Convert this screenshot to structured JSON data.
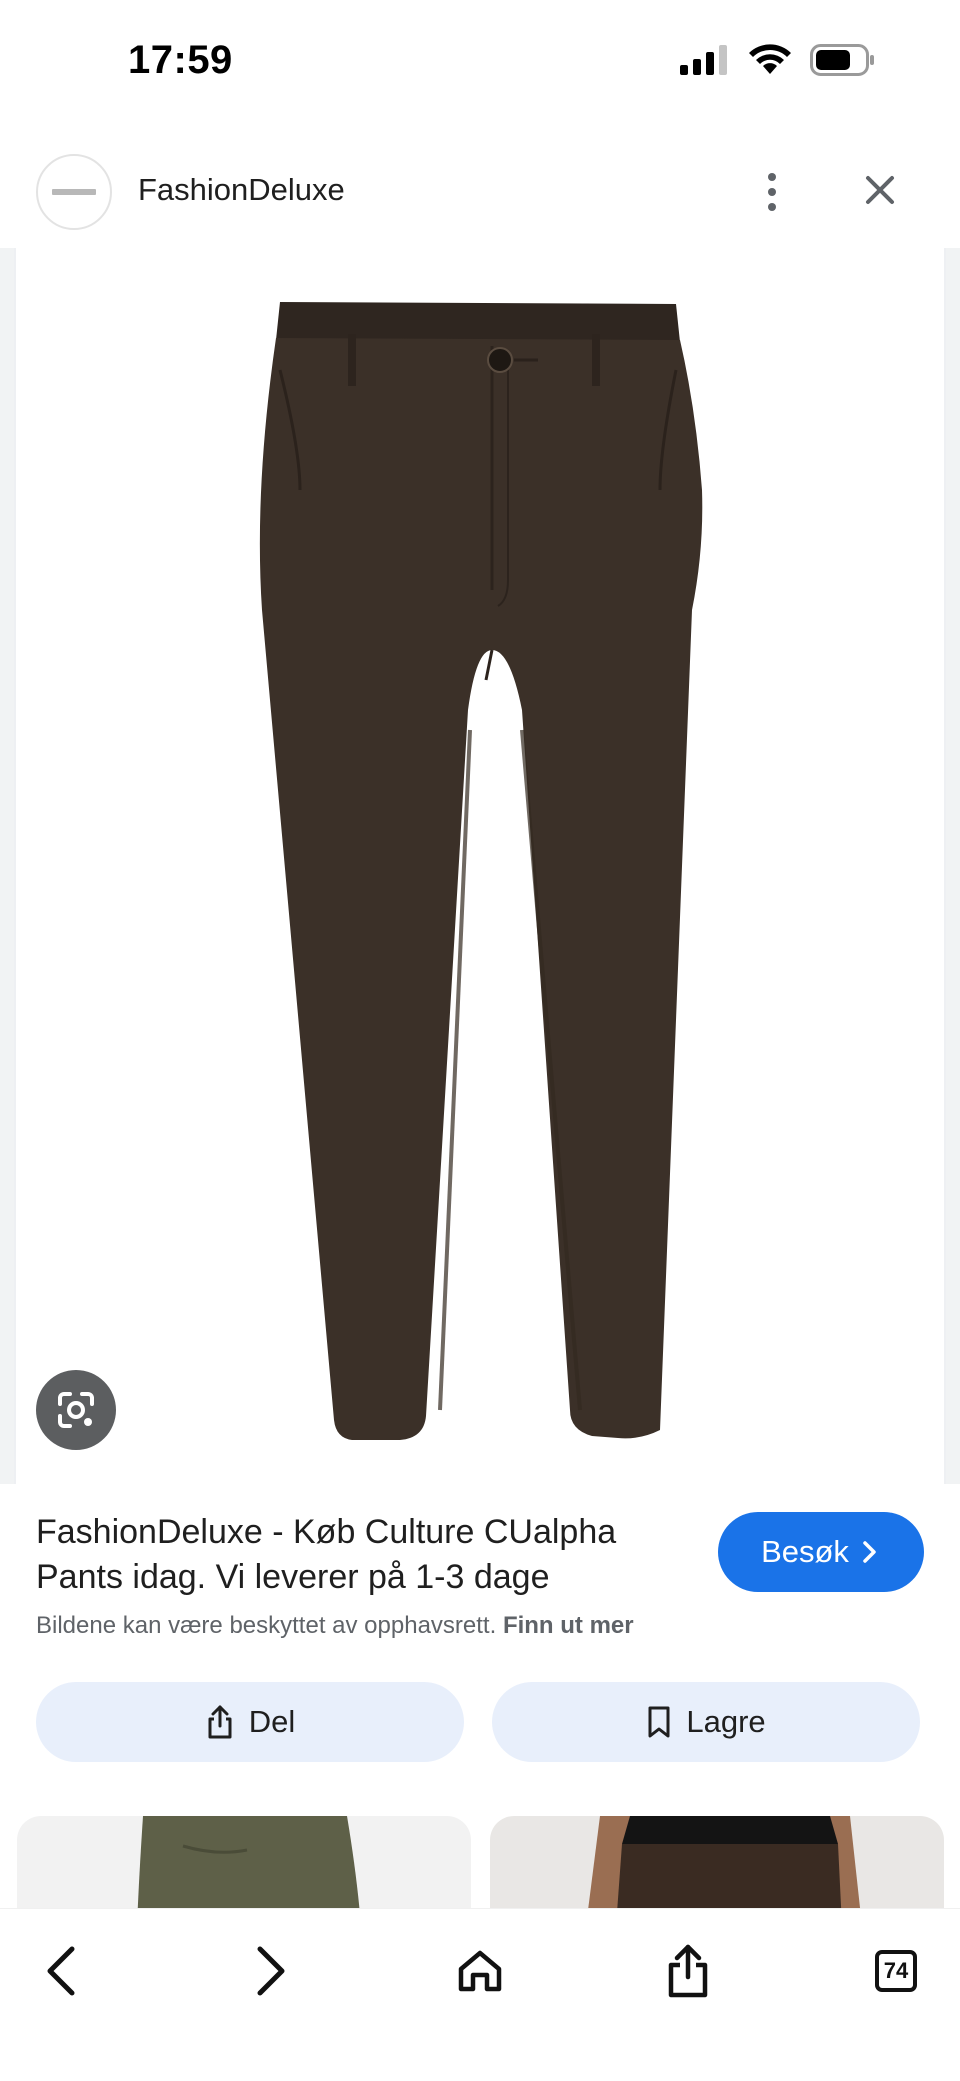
{
  "status_bar": {
    "time": "17:59",
    "icons": [
      "signal-icon",
      "wifi-icon",
      "battery-icon"
    ]
  },
  "header": {
    "site_name": "FashionDeluxe",
    "menu_icon": "more-vert-icon",
    "close_icon": "close-icon"
  },
  "product": {
    "image_description_icon": "google-lens-icon",
    "title": "FashionDeluxe - Køb Culture CUalpha Pants idag. Vi leverer på 1-3 dage",
    "visit_label": "Besøk",
    "copyright_text": "Bildene kan være beskyttet av opphavsrett.",
    "learn_more": "Finn ut mer"
  },
  "actions": {
    "share_label": "Del",
    "save_label": "Lagre"
  },
  "toolbar": {
    "tabs_count": "74"
  },
  "colors": {
    "accent": "#1a73e8",
    "action_bg": "#e8effb",
    "pants": "#3b3028"
  }
}
